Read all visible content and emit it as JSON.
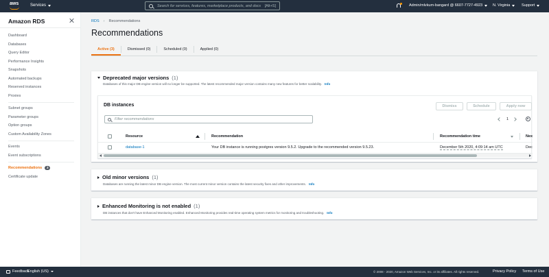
{
  "topnav": {
    "logo_text": "aws",
    "services_label": "Services",
    "search_placeholder": "Search for services, features, marketplace products, and docs",
    "search_shortcut": "[Alt+S]",
    "account": "Admin/mlvkum-bangard @ 6607-7727-4923",
    "region": "N. Virginia",
    "support": "Support"
  },
  "sidebar": {
    "title": "Amazon RDS",
    "groups": [
      [
        "Dashboard",
        "Databases",
        "Query Editor",
        "Performance Insights",
        "Snapshots",
        "Automated backups",
        "Reserved instances",
        "Proxies"
      ],
      [
        "Subnet groups",
        "Parameter groups",
        "Option groups",
        "Custom Availability Zones"
      ],
      [
        "Events",
        "Event subscriptions"
      ]
    ],
    "recommendations_label": "Recommendations",
    "recommendations_badge": "3",
    "certificate_label": "Certificate update"
  },
  "breadcrumb": {
    "root": "RDS",
    "current": "Recommendations"
  },
  "page_title": "Recommendations",
  "tabs": [
    "Active (3)",
    "Dismissed (0)",
    "Scheduled (0)",
    "Applied (0)"
  ],
  "panel1": {
    "title": "Deprecated major versions",
    "count": "(1)",
    "desc": "Databases of this major DB engine version will no longer be supported. The latest recommended major version contains many new features for better scalability.",
    "info": "Info",
    "db": {
      "title": "DB instances",
      "buttons": {
        "dismiss": "Dismiss",
        "schedule": "Schedule",
        "apply": "Apply now"
      },
      "filter_placeholder": "Filter recommendations",
      "page": "1",
      "columns": [
        "Resource",
        "Recommendation",
        "Recommendation time",
        "Next m"
      ],
      "rows": [
        {
          "resource": "database-1",
          "recommendation": "Your DB instance is running postgres version 9.5.2. Upgrade to the recommended version 9.5.23.",
          "time": "December 5th 2020, 4:09:14 am UTC",
          "next": "Decem"
        }
      ]
    }
  },
  "panel2": {
    "title": "Old minor versions",
    "count": "(1)",
    "desc": "Databases are running the latest minor DB engine version. The most current minor version contains the latest security fixes and other improvements.",
    "info": "Info"
  },
  "panel3": {
    "title": "Enhanced Monitoring is not enabled",
    "count": "(1)",
    "desc": "DB instances that don't have Enhanced Monitoring enabled. Enhanced Monitoring provides real-time operating system metrics for monitoring and troubleshooting.",
    "info": "Info"
  },
  "footer": {
    "feedback": "Feedback",
    "language": "English (US)",
    "copyright": "© 2008 - 2020, Amazon Web Services, Inc. or its affiliates. All rights reserved.",
    "privacy": "Privacy Policy",
    "terms": "Terms of Use"
  },
  "colors": {
    "nav_bg": "#232f3e",
    "accent": "#ec7211",
    "link": "#0073bb",
    "page_bg": "#f2f3f3"
  }
}
